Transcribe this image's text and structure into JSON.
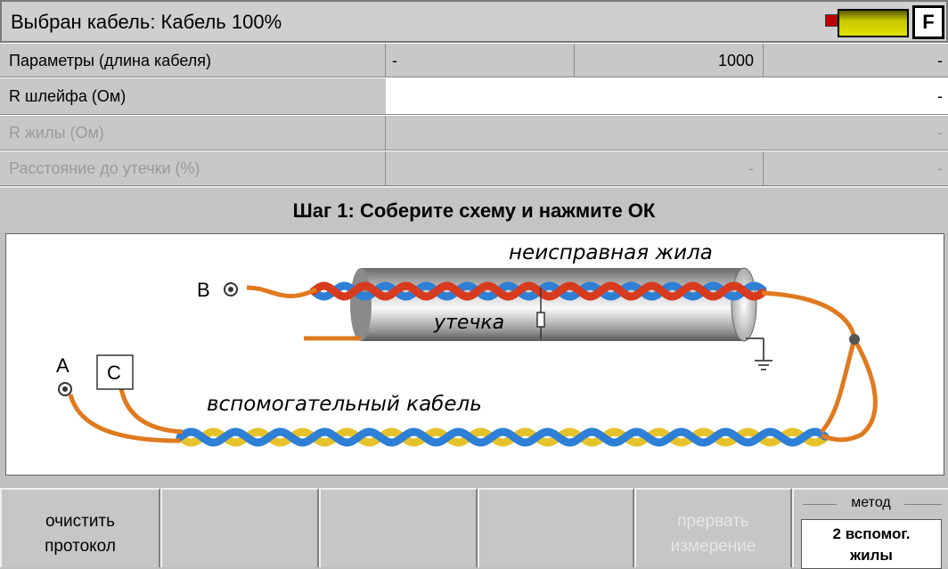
{
  "header": {
    "title": "Выбран кабель: Кабель 100%",
    "f_button": "F"
  },
  "params": [
    {
      "label": "Параметры (длина кабеля)",
      "v1": "-",
      "v2": "1000",
      "v3": "-",
      "disabled": false
    },
    {
      "label": "R шлейфа (Ом)",
      "v1": "",
      "v2": "",
      "v3": "-",
      "disabled": false
    },
    {
      "label": "R жилы (Ом)",
      "v1": "",
      "v2": "",
      "v3": "-",
      "disabled": true
    },
    {
      "label": "Расстояние до утечки (%)",
      "v1": "",
      "v2": "-",
      "v3": "-",
      "disabled": true
    }
  ],
  "step": {
    "text": "Шаг 1: Соберите схему и нажмите ОК"
  },
  "diagram": {
    "faulty_core": "неисправная жила",
    "leak": "утечка",
    "aux_cable": "вспомогательный кабель",
    "terminal_a": "A",
    "terminal_b": "B",
    "terminal_c": "C",
    "colors": {
      "orange": "#e07a1f",
      "blue": "#2e7fd6",
      "red": "#d83a1e",
      "yellow": "#e6c22a"
    }
  },
  "buttons": [
    {
      "label": "очистить\nпротокол",
      "disabled": false
    },
    {
      "label": "",
      "disabled": false
    },
    {
      "label": "",
      "disabled": false
    },
    {
      "label": "",
      "disabled": false
    },
    {
      "label": "прервать\nизмерение",
      "disabled": true
    }
  ],
  "method": {
    "caption": "метод",
    "value": "2 вспомог.\nжилы"
  }
}
